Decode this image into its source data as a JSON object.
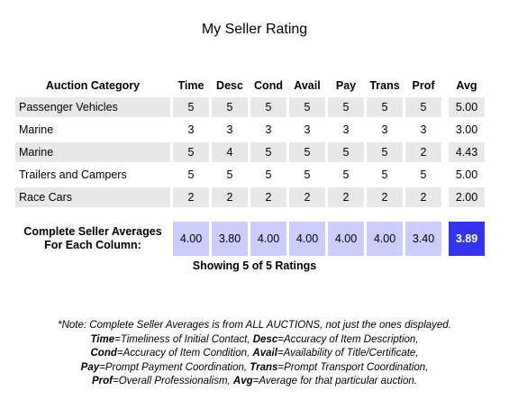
{
  "title": "My Seller Rating",
  "columns": {
    "category": "Auction Category",
    "time": "Time",
    "desc": "Desc",
    "cond": "Cond",
    "avail": "Avail",
    "pay": "Pay",
    "trans": "Trans",
    "prof": "Prof",
    "avg": "Avg"
  },
  "rows": [
    {
      "category": "Passenger Vehicles",
      "time": "5",
      "desc": "5",
      "cond": "5",
      "avail": "5",
      "pay": "5",
      "trans": "5",
      "prof": "5",
      "avg": "5.00"
    },
    {
      "category": "Marine",
      "time": "3",
      "desc": "3",
      "cond": "3",
      "avail": "3",
      "pay": "3",
      "trans": "3",
      "prof": "3",
      "avg": "3.00"
    },
    {
      "category": "Marine",
      "time": "5",
      "desc": "4",
      "cond": "5",
      "avail": "5",
      "pay": "5",
      "trans": "5",
      "prof": "2",
      "avg": "4.43"
    },
    {
      "category": "Trailers and Campers",
      "time": "5",
      "desc": "5",
      "cond": "5",
      "avail": "5",
      "pay": "5",
      "trans": "5",
      "prof": "5",
      "avg": "5.00"
    },
    {
      "category": "Race Cars",
      "time": "2",
      "desc": "2",
      "cond": "2",
      "avail": "2",
      "pay": "2",
      "trans": "2",
      "prof": "2",
      "avg": "2.00"
    }
  ],
  "averages": {
    "label_line1": "Complete Seller Averages",
    "label_line2": "For Each Column:",
    "time": "4.00",
    "desc": "3.80",
    "cond": "4.00",
    "avail": "4.00",
    "pay": "4.00",
    "trans": "4.00",
    "prof": "3.40",
    "overall": "3.89"
  },
  "showing": "Showing 5 of 5 Ratings",
  "note": {
    "line1": "*Note: Complete Seller Averages is from ALL AUCTIONS, not just the ones displayed.",
    "line2_time_key": "Time",
    "line2_time_desc": "=Timeliness of Initial Contact, ",
    "line2_desc_key": "Desc",
    "line2_desc_desc": "=Accuracy of Item Description,",
    "line3_cond_key": "Cond",
    "line3_cond_desc": "=Accuracy of Item Condition, ",
    "line3_avail_key": "Avail",
    "line3_avail_desc": "=Availability of Title/Certificate,",
    "line4_pay_key": "Pay",
    "line4_pay_desc": "=Prompt Payment Coordination, ",
    "line4_trans_key": "Trans",
    "line4_trans_desc": "=Prompt Transport Coordination,",
    "line5_prof_key": "Prof",
    "line5_prof_desc": "=Overall Professionalism, ",
    "line5_avg_key": "Avg",
    "line5_avg_desc": "=Average for that particular auction."
  },
  "colors": {
    "row_shade": "#e8e8e8",
    "avg_cell": "#ccccff",
    "overall_cell": "#3333ee"
  }
}
